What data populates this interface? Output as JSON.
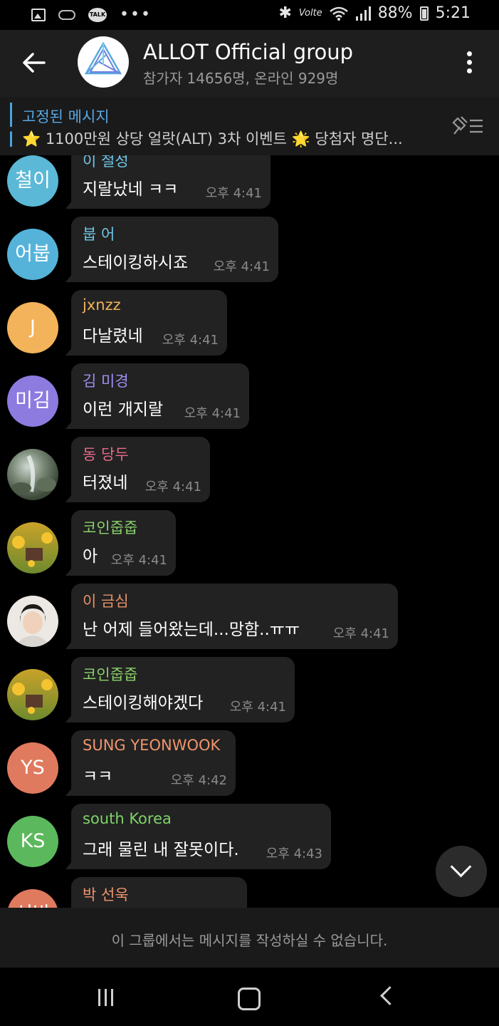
{
  "status_bar": {
    "left_icons": [
      "gallery-icon",
      "mail-icon",
      "talk-icon",
      "more-dots-icon"
    ],
    "talk_label": "TALK",
    "volte": "Volte",
    "battery": "88%",
    "time": "5:21"
  },
  "header": {
    "title": "ALLOT Official group",
    "subtitle": "참가자 14656명, 온라인 929명"
  },
  "pinned": {
    "label": "고정된 메시지",
    "text": "⭐ 1100만원 상당 얼랏(ALT) 3차 이벤트 🌟 당첨자 명단..."
  },
  "messages": [
    {
      "avatar_text": "철이",
      "avatar_color": "#5bb8d6",
      "sender": "이 철성",
      "sender_color": "#6fc6e6",
      "text": "지랄났네 ㅋㅋ",
      "time": "오후 4:41"
    },
    {
      "avatar_text": "어붑",
      "avatar_color": "#55b3d9",
      "sender": "붑 어",
      "sender_color": "#6fc6e6",
      "text": "스테이킹하시죠",
      "time": "오후 4:41"
    },
    {
      "avatar_text": "J",
      "avatar_color": "#f2b35a",
      "sender": "jxnzz",
      "sender_color": "#f2b35a",
      "text": "다날렸네",
      "time": "오후 4:41"
    },
    {
      "avatar_text": "미김",
      "avatar_color": "#8e7be0",
      "sender": "김 미경",
      "sender_color": "#a08ff0",
      "text": "이런 개지랄",
      "time": "오후 4:41"
    },
    {
      "avatar_text": "",
      "avatar_color": "#5d6a5a",
      "sender": "동 당두",
      "sender_color": "#e86a8a",
      "text": "터졌네",
      "time": "오후 4:41"
    },
    {
      "avatar_text": "",
      "avatar_color": "#6d8a2e",
      "sender": "코인줍줍",
      "sender_color": "#8ad16b",
      "text": "아",
      "time": "오후 4:41"
    },
    {
      "avatar_text": "",
      "avatar_color": "#e9e6e2",
      "sender": "이 금심",
      "sender_color": "#e8916a",
      "text": "난 어제 들어왔는데...망함..ㅠㅠ",
      "time": "오후 4:41"
    },
    {
      "avatar_text": "",
      "avatar_color": "#6d8a2e",
      "sender": "코인줍줍",
      "sender_color": "#8ad16b",
      "text": "스테이킹해야겠다",
      "time": "오후 4:41"
    },
    {
      "avatar_text": "YS",
      "avatar_color": "#e07a5f",
      "sender": "SUNG YEONWOOK",
      "sender_color": "#f0956d",
      "text": "ㅋㅋ",
      "time": "오후 4:42"
    },
    {
      "avatar_text": "KS",
      "avatar_color": "#5cb85c",
      "sender": "south Korea",
      "sender_color": "#7fd36a",
      "text": "그래 물린 내 잘못이다.",
      "time": "오후 4:43"
    },
    {
      "avatar_text": "선박",
      "avatar_color": "#e07a5f",
      "sender": "박 선욱",
      "sender_color": "#f0956d",
      "text": "",
      "time": ""
    }
  ],
  "footer": {
    "notice": "이 그룹에서는 메시지를 작성하실 수 없습니다."
  }
}
